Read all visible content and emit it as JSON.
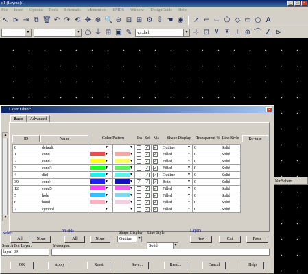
{
  "window": {
    "title": "d1 (Layout):1"
  },
  "menu": [
    "File",
    "Insert",
    "Options",
    "Tools",
    "Schematic",
    "Momentum",
    "EMDS",
    "Window",
    "DesignGuide",
    "Help"
  ],
  "toolbar2": {
    "layer_combo": "",
    "cell_combo": "",
    "layer_value": "v,s:diel"
  },
  "side_label": "NmSchem",
  "dialog": {
    "title": "Layer Editor:1",
    "tabs": [
      "Basic",
      "Advanced"
    ],
    "headers": {
      "id": "ID",
      "name": "Name",
      "color": "Color/Pattern",
      "ins": "Ins",
      "sel": "Sel",
      "vis": "Vis",
      "shape": "Shape Display",
      "transparent": "Transparent %",
      "line": "Line Style",
      "reverse": "Reverse"
    },
    "rows": [
      {
        "id": "0",
        "name": "default",
        "fill": "#ffffff",
        "pat": "#ffffff",
        "ins": "",
        "sel": "✓",
        "vis": "✓",
        "shape": "Outline",
        "transparent": "0",
        "line": "Solid"
      },
      {
        "id": "1",
        "name": "cond",
        "fill": "#e8504c",
        "pat": "#f0a8a0",
        "ins": "",
        "sel": "✓",
        "vis": "✓",
        "shape": "Filled",
        "transparent": "0",
        "line": "Solid"
      },
      {
        "id": "2",
        "name": "cond2",
        "fill": "#ffff20",
        "pat": "#ffff60",
        "ins": "",
        "sel": "✓",
        "vis": "✓",
        "shape": "Filled",
        "transparent": "0",
        "line": "Solid"
      },
      {
        "id": "3",
        "name": "cond3",
        "fill": "#20ff20",
        "pat": "#60f060",
        "ins": "",
        "sel": "✓",
        "vis": "✓",
        "shape": "Filled",
        "transparent": "0",
        "line": "Solid"
      },
      {
        "id": "4",
        "name": "diel",
        "fill": "#20f0f0",
        "pat": "#60f0f0",
        "ins": "",
        "sel": "✓",
        "vis": "✓",
        "shape": "Outline",
        "transparent": "0",
        "line": "Solid"
      },
      {
        "id": "39",
        "name": "cond4",
        "fill": "#2020ff",
        "pat": "#1010c0",
        "ins": "✓",
        "sel": "✓",
        "vis": "✓",
        "shape": "Both",
        "transparent": "0",
        "line": "Solid"
      },
      {
        "id": "12",
        "name": "cond5",
        "fill": "#ff40ff",
        "pat": "#f060f0",
        "ins": "",
        "sel": "✓",
        "vis": "✓",
        "shape": "Filled",
        "transparent": "0",
        "line": "Solid"
      },
      {
        "id": "5",
        "name": "hole",
        "fill": "#30c0ff",
        "pat": "#80d8f0",
        "ins": "",
        "sel": "✓",
        "vis": "✓",
        "shape": "Filled",
        "transparent": "0",
        "line": "Solid"
      },
      {
        "id": "6",
        "name": "bond",
        "fill": "#ffb0c0",
        "pat": "#f0d0e0",
        "ins": "",
        "sel": "✓",
        "vis": "✓",
        "shape": "Filled",
        "transparent": "0",
        "line": "Solid"
      },
      {
        "id": "7",
        "name": "symbol",
        "fill": "#ffffff",
        "pat": "#ffffff",
        "ins": "",
        "sel": "✓",
        "vis": "✓",
        "shape": "Filled",
        "transparent": "0",
        "line": "Solid"
      }
    ],
    "group_labels": {
      "select": "Select",
      "visible": "Visible",
      "layers": "Layers",
      "shape": "Shape Display",
      "line": "Line Style"
    },
    "buttons": {
      "sel_all": "All",
      "sel_none": "None",
      "vis_all": "All",
      "vis_none": "None",
      "shape_val": "Outline",
      "line_val": "Solid",
      "new": "New",
      "cut": "Cut",
      "paste": "Paste",
      "reverse": "Reverse"
    },
    "search": {
      "label": "Search For Layer:",
      "value": "layer_39",
      "messages_label": "Messages:"
    },
    "footer": {
      "ok": "OK",
      "apply": "Apply",
      "reset": "Reset",
      "save": "Save...",
      "read": "Read...",
      "cancel": "Cancel",
      "help": "Help"
    }
  }
}
